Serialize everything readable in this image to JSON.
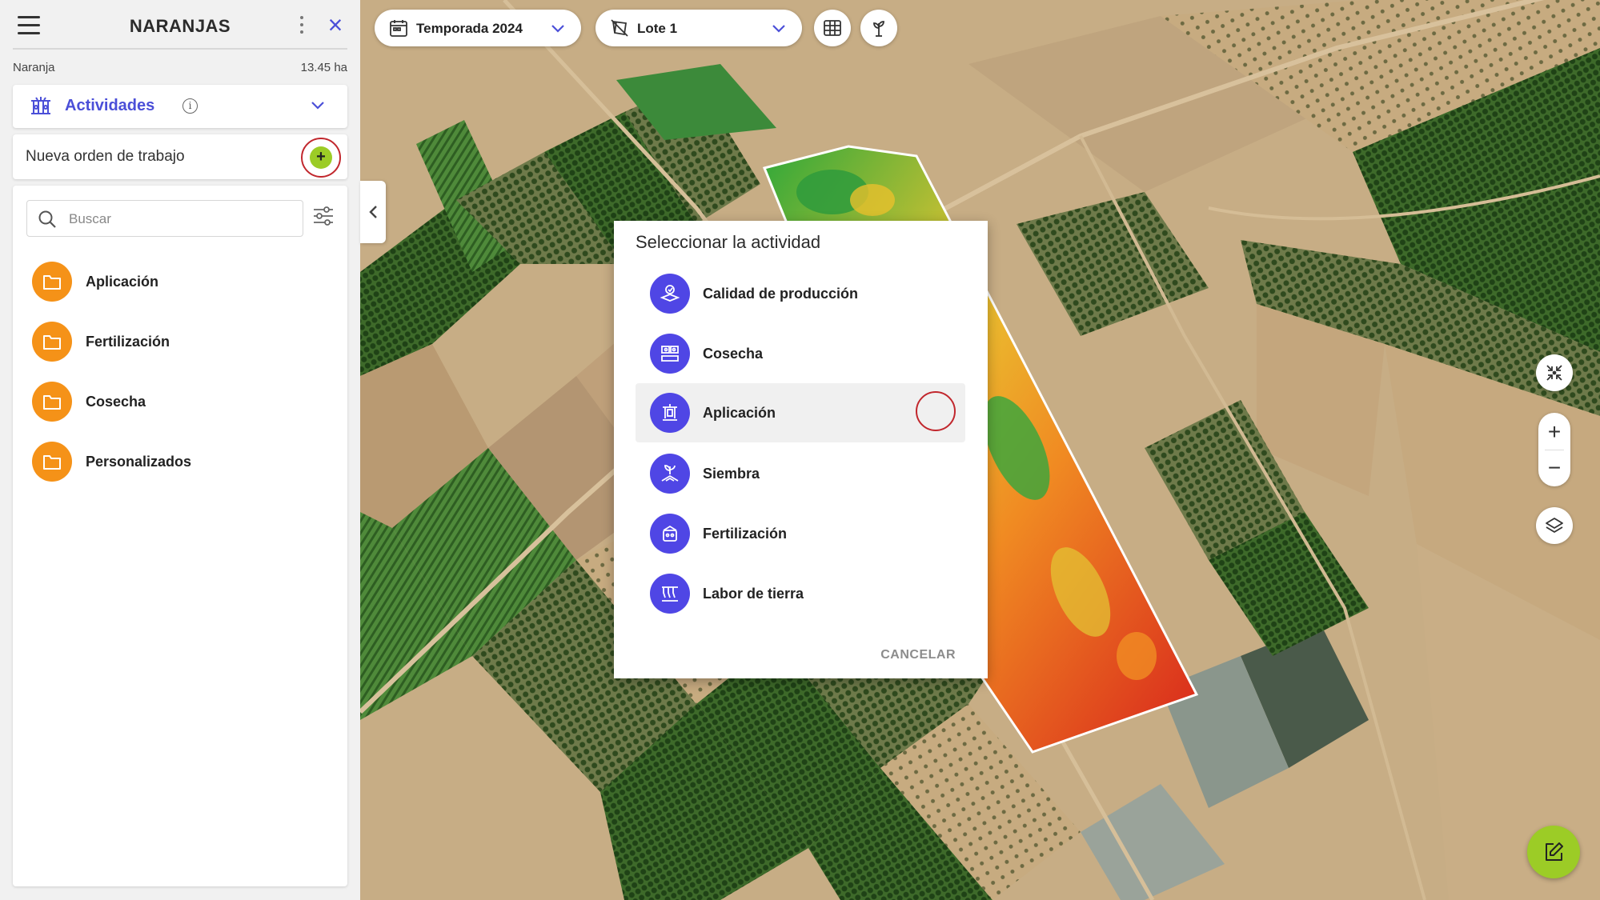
{
  "sidebar": {
    "title": "NARANJAS",
    "crop_name": "Naranja",
    "crop_area": "13.45 ha",
    "activities_label": "Actividades",
    "new_order_label": "Nueva orden de trabajo",
    "search_placeholder": "Buscar",
    "folders": [
      {
        "label": "Aplicación"
      },
      {
        "label": "Fertilización"
      },
      {
        "label": "Cosecha"
      },
      {
        "label": "Personalizados"
      }
    ]
  },
  "toolbar": {
    "season_label": "Temporada 2024",
    "lot_label": "Lote 1"
  },
  "modal": {
    "title": "Seleccionar la actividad",
    "options": [
      {
        "label": "Calidad de producción",
        "icon": "quality-icon"
      },
      {
        "label": "Cosecha",
        "icon": "harvest-icon"
      },
      {
        "label": "Aplicación",
        "icon": "application-icon",
        "selected": true
      },
      {
        "label": "Siembra",
        "icon": "sowing-icon"
      },
      {
        "label": "Fertilización",
        "icon": "fertilization-icon"
      },
      {
        "label": "Labor de tierra",
        "icon": "tillage-icon"
      }
    ],
    "cancel_label": "CANCELAR"
  },
  "colors": {
    "accent": "#4b4fd8",
    "activity_icon_bg": "#4f46e5",
    "folder_orange": "#f59218",
    "action_green": "#9ccc26",
    "highlight_ring": "#c1272d"
  }
}
